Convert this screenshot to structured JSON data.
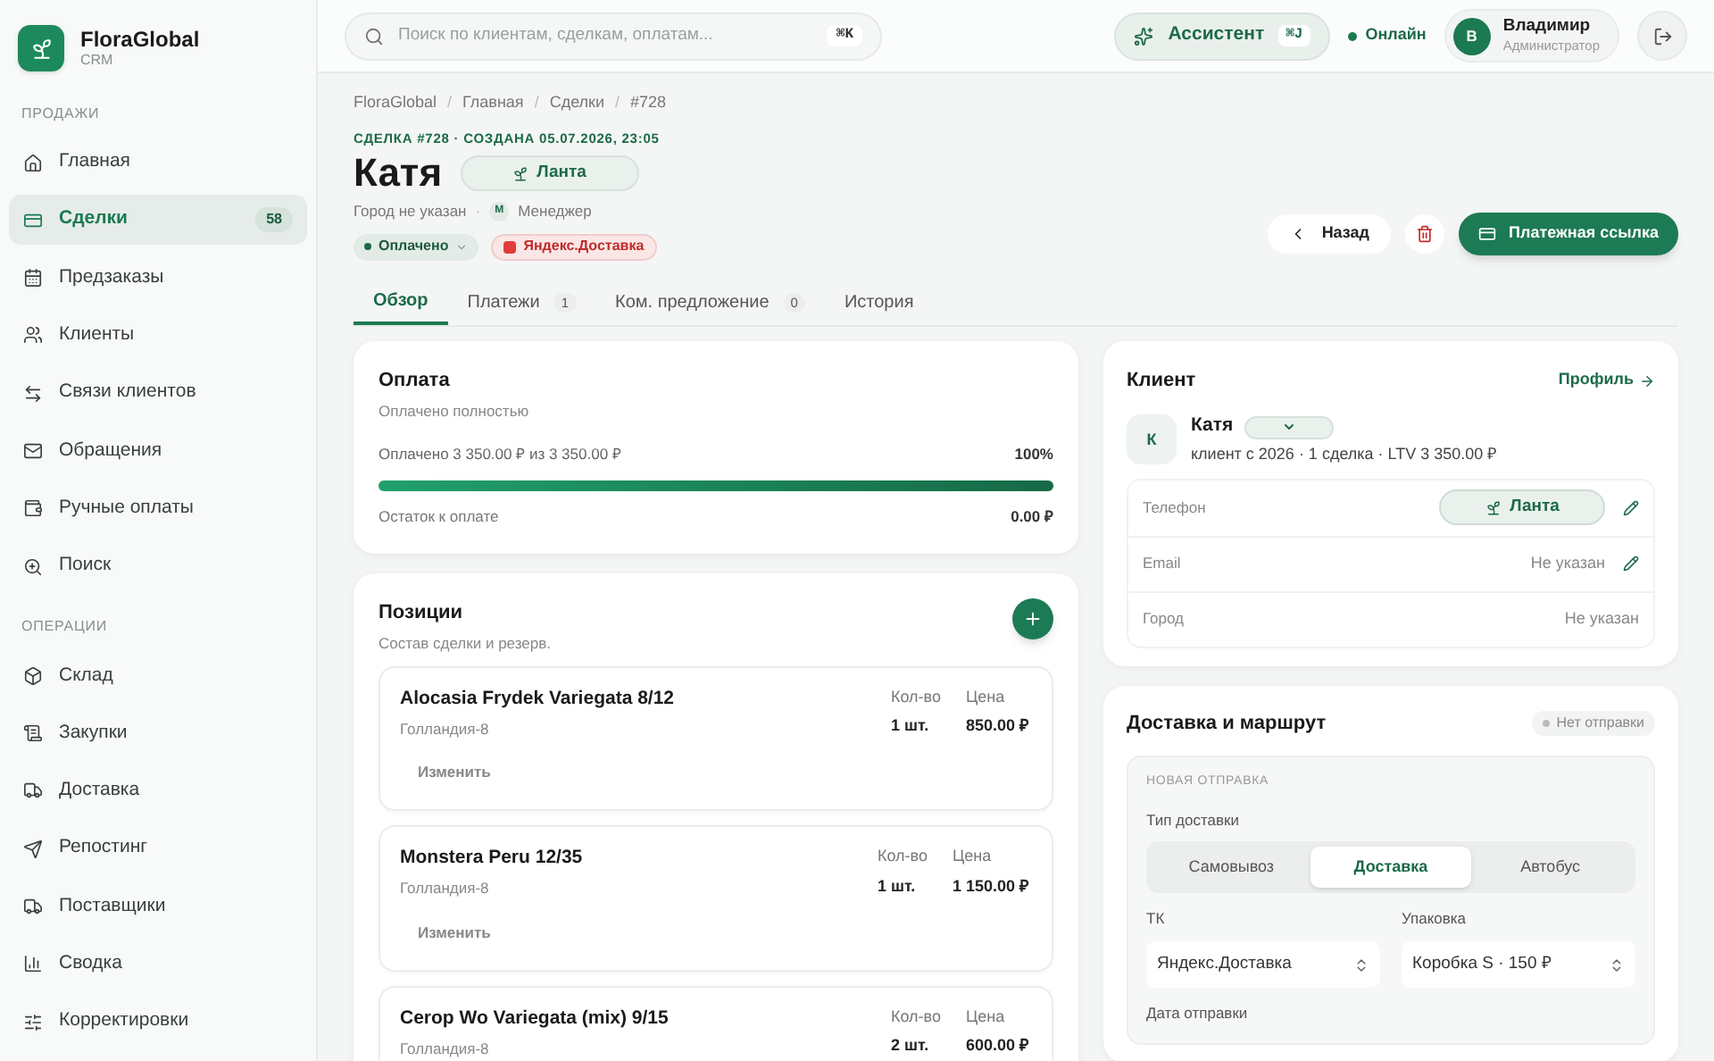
{
  "app": {
    "name": "FloraGlobal",
    "sub": "CRM"
  },
  "sidebar": {
    "sections": [
      {
        "title": "ПРОДАЖИ",
        "items": [
          {
            "label": "Главная",
            "selected": false
          },
          {
            "label": "Сделки",
            "selected": true,
            "badge": "58"
          },
          {
            "label": "Предзаказы",
            "selected": false
          },
          {
            "label": "Клиенты",
            "selected": false
          },
          {
            "label": "Связи клиентов",
            "selected": false
          },
          {
            "label": "Обращения",
            "selected": false
          },
          {
            "label": "Ручные оплаты",
            "selected": false
          },
          {
            "label": "Поиск",
            "selected": false
          }
        ]
      },
      {
        "title": "ОПЕРАЦИИ",
        "items": [
          {
            "label": "Склад",
            "selected": false
          },
          {
            "label": "Закупки",
            "selected": false
          },
          {
            "label": "Доставка",
            "selected": false
          },
          {
            "label": "Репостинг",
            "selected": false
          },
          {
            "label": "Поставщики",
            "selected": false
          },
          {
            "label": "Сводка",
            "selected": false
          },
          {
            "label": "Корректировки",
            "selected": false
          }
        ]
      }
    ]
  },
  "header": {
    "search": {
      "placeholder": "Поиск по клиентам, сделкам, оплатам...",
      "shortcut": "⌘K"
    },
    "assistant": {
      "label": "Ассистент",
      "shortcut": "⌘J"
    },
    "status": "Онлайн",
    "user": {
      "initial": "В",
      "name": "Владимир",
      "role": "Администратор"
    }
  },
  "breadcrumbs": {
    "separator": "/",
    "items": [
      "FloraGlobal",
      "Главная",
      "Сделки",
      "#728"
    ]
  },
  "deal": {
    "meta": "СДЕЛКА #728 · СОЗДАНА 05.07.2026, 23:05",
    "title": "Катя",
    "tag": "Ланта",
    "city": "Город не указан",
    "separator": "·",
    "manager_initial": "М",
    "manager": "Менеджер",
    "status": "Оплачено",
    "delivery_badge": "Яндекс.Доставка"
  },
  "actions": {
    "back": "Назад",
    "pay_link": "Платежная ссылка"
  },
  "tabs": [
    {
      "label": "Обзор",
      "selected": true
    },
    {
      "label": "Платежи",
      "count": "1",
      "selected": false
    },
    {
      "label": "Ком. предложение",
      "count": "0",
      "selected": false
    },
    {
      "label": "История",
      "selected": false
    }
  ],
  "payment": {
    "title": "Оплата",
    "subtitle": "Оплачено полностью",
    "paid_text": "Оплачено 3 350.00 ₽ из 3 350.00 ₽",
    "percent": "100%",
    "level": 1,
    "remaining_label": "Остаток к оплате",
    "remaining_value": "0.00 ₽"
  },
  "positions": {
    "title": "Позиции",
    "subtitle": "Состав сделки и резерв.",
    "items": [
      {
        "name": "Alocasia Frydek Variegata 8/12",
        "supplier": "Голландия-8",
        "qty_label": "Кол-во",
        "qty": "1 шт.",
        "price_label": "Цена",
        "price": "850.00 ₽",
        "edit": "Изменить"
      },
      {
        "name": "Monstera Peru 12/35",
        "supplier": "Голландия-8",
        "qty_label": "Кол-во",
        "qty": "1 шт.",
        "price_label": "Цена",
        "price": "1 150.00 ₽",
        "edit": "Изменить"
      },
      {
        "name": "Cerop Wo Variegata (mix) 9/15",
        "supplier": "Голландия-8",
        "qty_label": "Кол-во",
        "qty": "2 шт.",
        "price_label": "Цена",
        "price": "600.00 ₽"
      }
    ]
  },
  "client": {
    "title": "Клиент",
    "profile_link": "Профиль",
    "initial": "К",
    "name": "Катя",
    "summary": "клиент с 2026 · 1 сделка · LTV 3 350.00 ₽",
    "fields": [
      {
        "label": "Телефон",
        "kind": "tag",
        "value": "Ланта",
        "editable": true
      },
      {
        "label": "Email",
        "kind": "text",
        "value": "Не указан",
        "editable": true
      },
      {
        "label": "Город",
        "kind": "text",
        "value": "Не указан",
        "editable": false
      }
    ]
  },
  "delivery": {
    "title": "Доставка и маршрут",
    "status": "Нет отправки",
    "section": "НОВАЯ ОТПРАВКА",
    "type_label": "Тип доставки",
    "options": [
      {
        "label": "Самовывоз",
        "selected": false
      },
      {
        "label": "Доставка",
        "selected": true
      },
      {
        "label": "Автобус",
        "selected": false
      }
    ],
    "fields": [
      {
        "label": "ТК",
        "value": "Яндекс.Доставка"
      },
      {
        "label": "Упаковка",
        "value": "Коробка S · 150 ₽"
      }
    ],
    "date_label": "Дата отправки"
  }
}
